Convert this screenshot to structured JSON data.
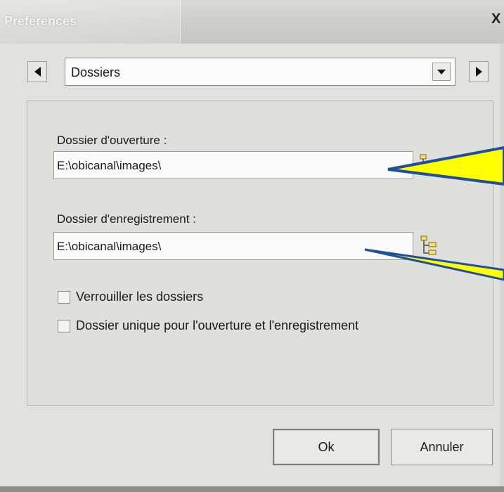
{
  "window": {
    "title": "Préférences",
    "close_label": "X"
  },
  "navigation": {
    "selected_section": "Dossiers"
  },
  "open_folder": {
    "label": "Dossier d'ouverture :",
    "value": "E:\\obicanal\\images\\"
  },
  "save_folder": {
    "label": "Dossier d'enregistrement :",
    "value": "E:\\obicanal\\images\\"
  },
  "options": [
    {
      "label": "Verrouiller les dossiers",
      "checked": false
    },
    {
      "label": "Dossier unique pour l'ouverture et l'enregistrement",
      "checked": false
    }
  ],
  "buttons": {
    "ok": "Ok",
    "cancel": "Annuler"
  },
  "icons": [
    "arrow-left-icon",
    "arrow-right-icon",
    "dropdown-arrow-icon",
    "folder-tree-icon",
    "close-icon"
  ],
  "colors": {
    "callout_fill": "#ffff00",
    "callout_stroke": "#1f4f9d"
  }
}
